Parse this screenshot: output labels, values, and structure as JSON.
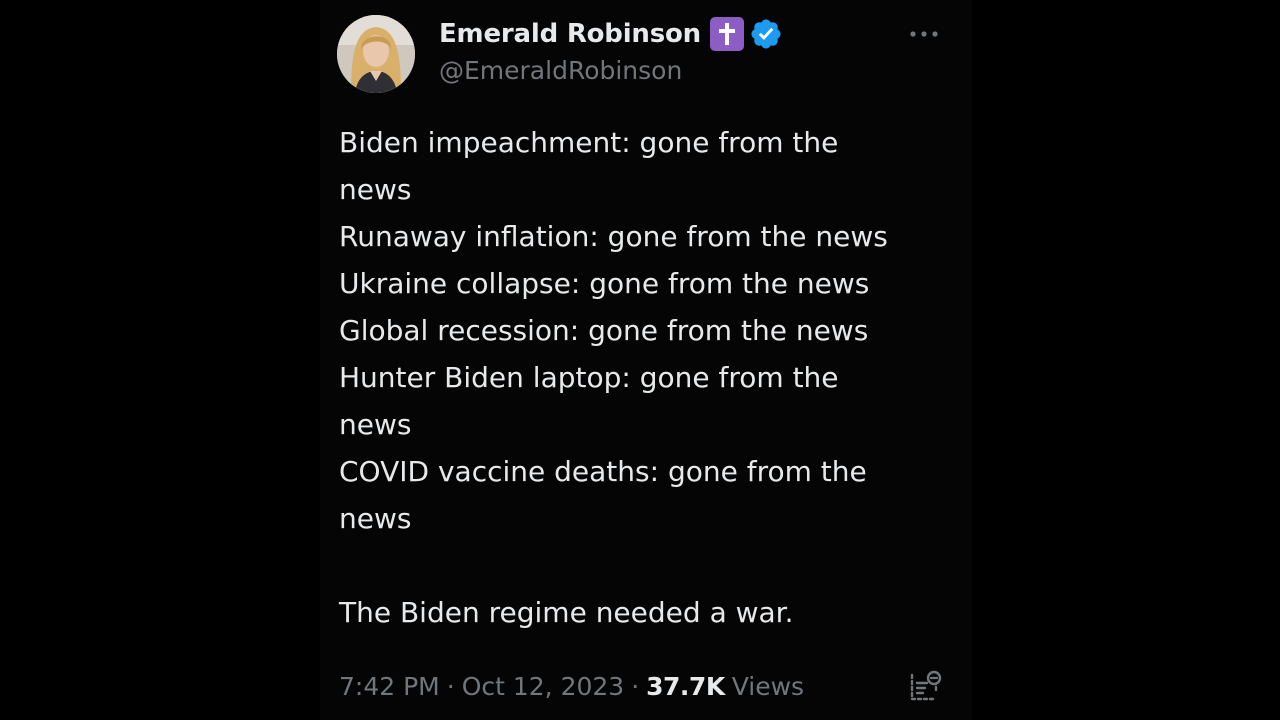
{
  "author": {
    "display_name": "Emerald Robinson",
    "handle": "@EmeraldRobinson",
    "avatar_icon": "profile-photo",
    "badges": [
      "cross-badge",
      "verified-badge"
    ]
  },
  "tweet": {
    "lines": [
      "Biden impeachment: gone from the",
      "news",
      "Runaway inflation: gone from the news",
      "Ukraine collapse: gone from the news",
      "Global recession: gone from the news",
      "Hunter Biden laptop: gone from the",
      "news",
      "COVID vaccine deaths: gone from the",
      "news",
      "",
      "The Biden regime needed a war."
    ]
  },
  "meta": {
    "time": "7:42 PM",
    "separator": "·",
    "date": "Oct 12, 2023",
    "views_count": "37.7K",
    "views_label": "Views"
  },
  "icons": {
    "more": "more-horizontal-icon",
    "analytics": "analytics-icon"
  },
  "colors": {
    "background": "#000000",
    "text": "#e7e9ea",
    "secondary_text": "#71767b",
    "verified_blue": "#1d9bf0",
    "cross_badge_purple": "#8c5ec5"
  }
}
